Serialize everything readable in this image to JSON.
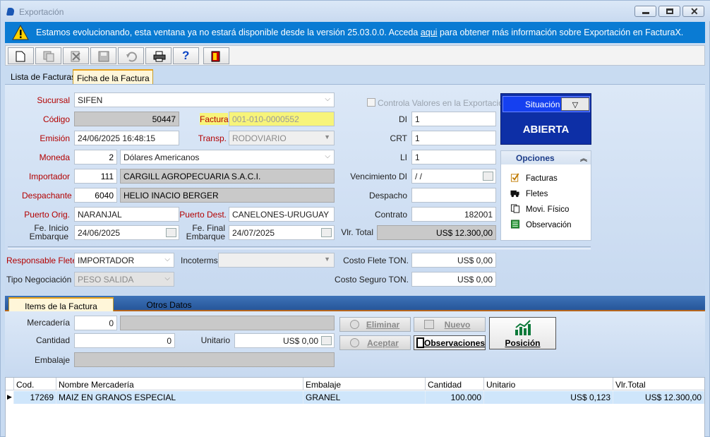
{
  "window": {
    "title": "Exportación"
  },
  "banner": {
    "text_before": "Estamos evolucionando, esta ventana ya no estará disponible desde la versión 25.03.0.0. Acceda",
    "link": "aqui",
    "text_after": "para obtener más información sobre Exportación en FacturaX."
  },
  "toolbar": {
    "buttons": [
      "new-document-icon",
      "copy-icon",
      "delete-icon",
      "save-icon",
      "undo-icon",
      "print-icon",
      "help-icon",
      "exit-icon"
    ]
  },
  "tabs": [
    "Lista de Facturas",
    "Ficha de la Factura"
  ],
  "form": {
    "sucursal": {
      "label": "Sucursal",
      "value": "SIFEN"
    },
    "codigo": {
      "label": "Código",
      "value": "50447"
    },
    "factura": {
      "label": "Factura",
      "value": "001-010-0000552"
    },
    "emision": {
      "label": "Emisión",
      "value": "24/06/2025 16:48:15"
    },
    "transp": {
      "label": "Transp.",
      "value": "RODOVIARIO"
    },
    "moneda": {
      "label": "Moneda",
      "code": "2",
      "value": "Dólares Americanos"
    },
    "importador": {
      "label": "Importador",
      "code": "111",
      "value": "CARGILL AGROPECUARIA S.A.C.I."
    },
    "despachante": {
      "label": "Despachante",
      "code": "6040",
      "value": "HELIO INACIO BERGER"
    },
    "puerto_orig": {
      "label": "Puerto Orig.",
      "value": "NARANJAL"
    },
    "puerto_dest": {
      "label": "Puerto Dest.",
      "value": "CANELONES-URUGUAY"
    },
    "fe_inicio": {
      "label1": "Fe. Inicio",
      "label2": "Embarque",
      "value": "24/06/2025"
    },
    "fe_final": {
      "label1": "Fe. Final",
      "label2": "Embarque",
      "value": "24/07/2025"
    },
    "controla": {
      "label": "Controla Valores en la Exportación"
    },
    "di": {
      "label": "DI",
      "value": "1"
    },
    "crt": {
      "label": "CRT",
      "value": "1"
    },
    "li": {
      "label": "LI",
      "value": "1"
    },
    "vencimiento": {
      "label": "Vencimiento DI",
      "value": " /  /"
    },
    "despacho": {
      "label": "Despacho",
      "value": ""
    },
    "contrato": {
      "label": "Contrato",
      "value": "182001"
    },
    "vlr_total": {
      "label": "Vlr. Total",
      "value": "US$ 12.300,00"
    },
    "responsable": {
      "label": "Responsable Flete",
      "value": "IMPORTADOR"
    },
    "incoterms": {
      "label": "Incoterms",
      "value": ""
    },
    "tipo_negociacion": {
      "label": "Tipo Negociación",
      "value": "PESO SALIDA"
    },
    "costo_flete": {
      "label": "Costo Flete TON.",
      "value": "US$ 0,00"
    },
    "costo_seguro": {
      "label": "Costo Seguro TON.",
      "value": "US$ 0,00"
    }
  },
  "situacion": {
    "label": "Situación",
    "status": "ABIERTA",
    "btn": "▽"
  },
  "opciones": {
    "title": "Opciones",
    "items": [
      "Facturas",
      "Fletes",
      "Movi. Físico",
      "Observación"
    ]
  },
  "tabs2": [
    "Items de la Factura",
    "Otros Datos"
  ],
  "items_form": {
    "mercaderia": {
      "label": "Mercadería",
      "code": "0",
      "value": ""
    },
    "cantidad": {
      "label": "Cantidad",
      "value": "0"
    },
    "unitario": {
      "label": "Unitario",
      "value": "US$ 0,00"
    },
    "embalaje": {
      "label": "Embalaje",
      "value": ""
    }
  },
  "buttons": {
    "eliminar": "Eliminar",
    "nuevo": "Nuevo",
    "aceptar": "Aceptar",
    "observaciones": "Observaciones",
    "posicion": "Posición"
  },
  "grid": {
    "columns": [
      "Cod.",
      "Nombre Mercadería",
      "Embalaje",
      "Cantidad",
      "Unitario",
      "Vlr.Total"
    ],
    "rows": [
      [
        "17269",
        "MAIZ EN GRANOS ESPECIAL",
        "GRANEL",
        "100.000",
        "US$ 0,123",
        "US$ 12.300,00"
      ]
    ]
  },
  "colors": {
    "banner": "#0a7bd3",
    "situacion_bg": "#0d2fa6",
    "required_label": "#b30000"
  }
}
